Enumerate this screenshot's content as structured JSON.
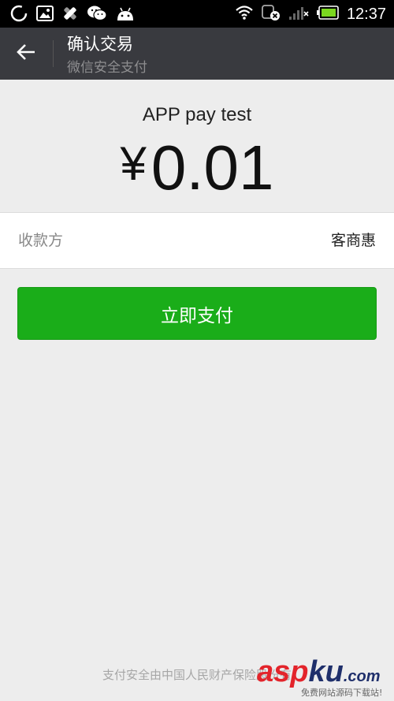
{
  "status_bar": {
    "time": "12:37"
  },
  "header": {
    "title": "确认交易",
    "subtitle": "微信安全支付"
  },
  "order": {
    "product_name": "APP pay test",
    "currency_symbol": "¥",
    "amount": "0.01"
  },
  "payee": {
    "label": "收款方",
    "value": "客商惠"
  },
  "actions": {
    "pay_label": "立即支付"
  },
  "footer": {
    "note": "支付安全由中国人民财产保险股份有"
  },
  "watermark": {
    "main_asp": "asp",
    "main_ku": "ku",
    "main_com": ".com",
    "sub": "免费网站源码下载站!"
  },
  "colors": {
    "header_bg": "#393a3f",
    "pay_button": "#1aad19",
    "page_bg": "#ededed"
  },
  "icons": {
    "status_left": [
      "loading-icon",
      "image-icon",
      "tools-icon",
      "wechat-icon",
      "android-icon"
    ],
    "status_right": [
      "wifi-icon",
      "data-disabled-icon",
      "signal-icon",
      "battery-icon"
    ],
    "header": [
      "back-arrow-icon"
    ]
  }
}
